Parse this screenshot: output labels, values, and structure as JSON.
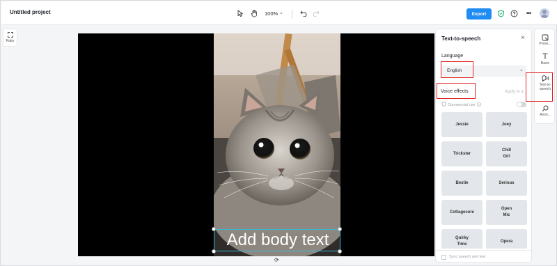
{
  "header": {
    "project_title": "Untitled project",
    "zoom": "100%",
    "export_label": "Export"
  },
  "left_rail": {
    "ratio_label": "Ratio"
  },
  "canvas": {
    "body_text": "Add body text"
  },
  "panel": {
    "title": "Text-to-speech",
    "language_label": "Language",
    "language_value": "English",
    "voice_effects_label": "Voice effects",
    "apply_label": "Apply to a",
    "commercial_label": "Commercial use",
    "voices": [
      "Jessie",
      "Joey",
      "Trickster",
      "Chill Girl",
      "Bestie",
      "Serious",
      "Cottagecore",
      "Open Mic",
      "Quirky Time",
      "Opera"
    ],
    "sync_label": "Sync speech and text"
  },
  "right_rail": {
    "items": [
      {
        "label": "Prese...",
        "icon": "presets-icon"
      },
      {
        "label": "Basic",
        "icon": "text-icon"
      },
      {
        "label": "Text-to-speech",
        "icon": "text-to-speech-icon"
      },
      {
        "label": "Anim...",
        "icon": "animation-icon"
      }
    ]
  },
  "colors": {
    "accent": "#1e8cf2",
    "highlight": "#e02020",
    "selection": "#38b8d8"
  }
}
